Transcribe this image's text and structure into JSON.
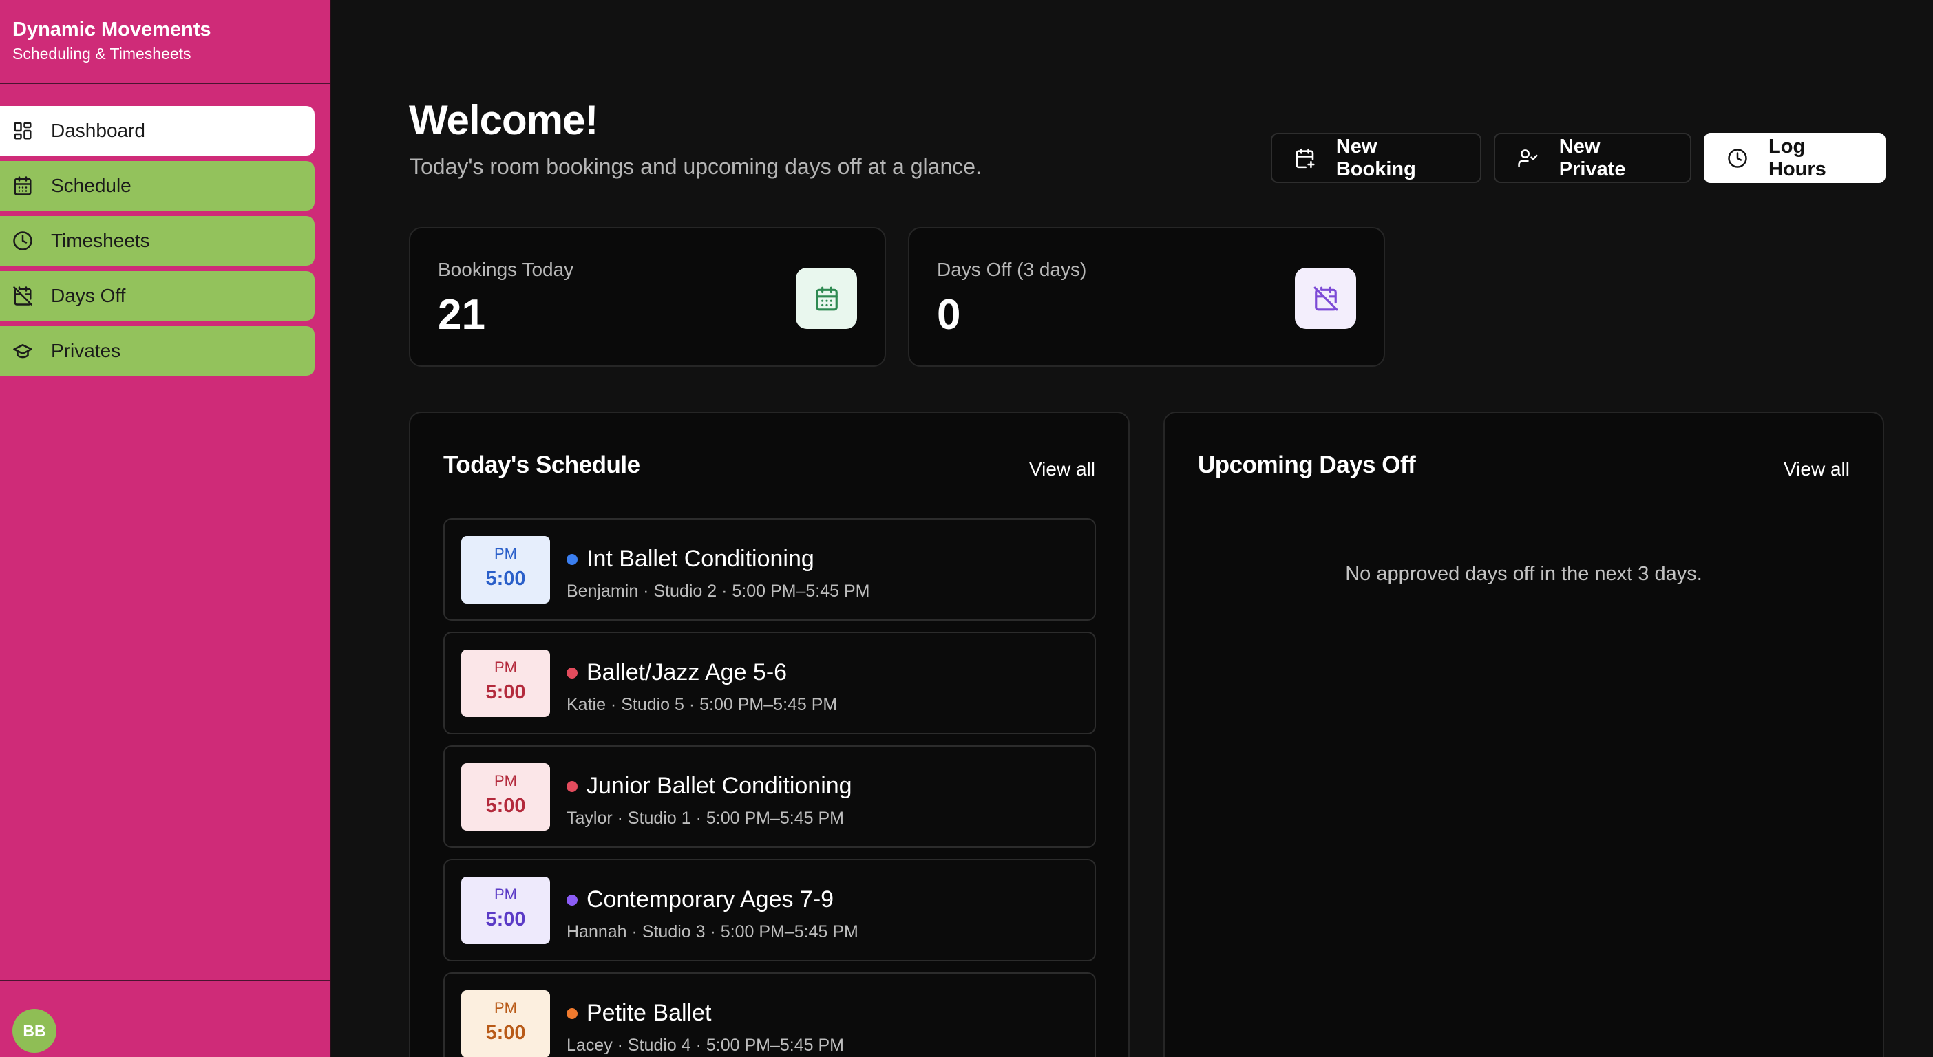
{
  "brand": {
    "title": "Dynamic Movements",
    "subtitle": "Scheduling & Timesheets"
  },
  "sidebar": {
    "items": [
      {
        "label": "Dashboard",
        "icon": "dashboard-icon",
        "active": true
      },
      {
        "label": "Schedule",
        "icon": "calendar-icon",
        "active": false
      },
      {
        "label": "Timesheets",
        "icon": "clock-icon",
        "active": false
      },
      {
        "label": "Days Off",
        "icon": "calendar-off-icon",
        "active": false
      },
      {
        "label": "Privates",
        "icon": "graduation-cap-icon",
        "active": false
      }
    ],
    "user_initials": "BB"
  },
  "header": {
    "title": "Welcome!",
    "subtitle": "Today's room bookings and upcoming days off at a glance."
  },
  "actions": {
    "new_booking": "New Booking",
    "new_private": "New Private",
    "log_hours": "Log Hours"
  },
  "stats": {
    "bookings_label": "Bookings Today",
    "bookings_value": "21",
    "daysoff_label": "Days Off (3 days)",
    "daysoff_value": "0"
  },
  "schedule": {
    "title": "Today's Schedule",
    "view_all": "View all",
    "events": [
      {
        "ampm": "PM",
        "time": "5:00",
        "title": "Int Ballet Conditioning",
        "meta": "Benjamin · Studio 2 · 5:00 PM–5:45 PM",
        "color": "#3b7ff0",
        "badge_bg": "#e6eefc",
        "badge_fg": "#2a5fc9"
      },
      {
        "ampm": "PM",
        "time": "5:00",
        "title": "Ballet/Jazz Age 5-6",
        "meta": "Katie · Studio 5 · 5:00 PM–5:45 PM",
        "color": "#e34c5d",
        "badge_bg": "#fbe6e8",
        "badge_fg": "#b32a3c"
      },
      {
        "ampm": "PM",
        "time": "5:00",
        "title": "Junior Ballet Conditioning",
        "meta": "Taylor · Studio 1 · 5:00 PM–5:45 PM",
        "color": "#e34c5d",
        "badge_bg": "#fbe6e8",
        "badge_fg": "#b32a3c"
      },
      {
        "ampm": "PM",
        "time": "5:00",
        "title": "Contemporary Ages 7-9",
        "meta": "Hannah · Studio 3 · 5:00 PM–5:45 PM",
        "color": "#8b5cf6",
        "badge_bg": "#eeeafc",
        "badge_fg": "#5b3bc6"
      },
      {
        "ampm": "PM",
        "time": "5:00",
        "title": "Petite Ballet",
        "meta": "Lacey · Studio 4 · 5:00 PM–5:45 PM",
        "color": "#f07a2e",
        "badge_bg": "#fcefdf",
        "badge_fg": "#b85a18"
      }
    ]
  },
  "days_off": {
    "title": "Upcoming Days Off",
    "view_all": "View all",
    "empty": "No approved days off in the next 3 days."
  }
}
